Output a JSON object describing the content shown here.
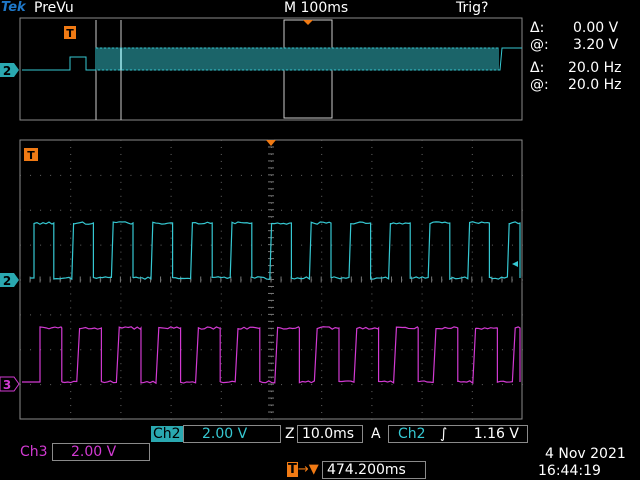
{
  "topbar": {
    "brand": "Tek",
    "mode": "PreVu",
    "timebase": "M 100ms",
    "trigger_status": "Trig?"
  },
  "cursors": {
    "delta_v_label": "Δ:",
    "delta_v_value": "0.00 V",
    "at_v_label": "@:",
    "at_v_value": "3.20 V",
    "delta_f_label": "Δ:",
    "delta_f_value": "20.0 Hz",
    "at_f_label": "@:",
    "at_f_value": "20.0 Hz"
  },
  "channels": {
    "ch2_marker": "2",
    "ch3_marker": "3",
    "trigger_marker": "T"
  },
  "settings": {
    "ch2_label": "Ch2",
    "ch2_scale": "2.00 V",
    "zoom_prefix": "Z",
    "zoom_time": "10.0ms",
    "acq_prefix": "A",
    "trig_source": "Ch2",
    "trig_slope": "∫",
    "trig_level": "1.16 V",
    "ch3_label": "Ch3",
    "ch3_scale": "2.00 V",
    "position_value": "474.200ms"
  },
  "datetime": {
    "date": "4 Nov 2021",
    "time": "16:44:19"
  },
  "colors": {
    "ch2": "#36c8d2",
    "ch3": "#d23ad2",
    "trigger": "#f07a14",
    "grid": "#8a8a8a"
  }
}
